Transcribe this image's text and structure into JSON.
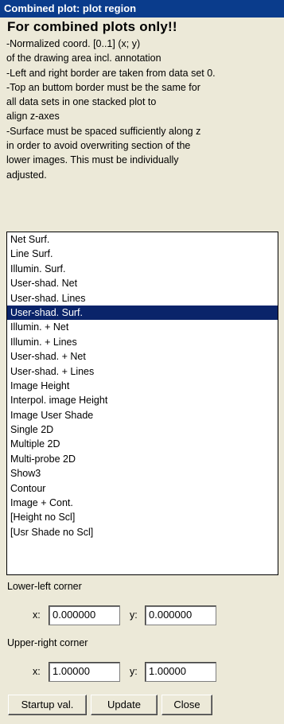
{
  "window": {
    "title": "Combined plot: plot region"
  },
  "heading": "For combined plots only!!",
  "info_lines": [
    "-Normalized coord. [0..1] (x; y)",
    "of the drawing area incl. annotation",
    "-Left and right border are taken from data set 0.",
    "-Top an buttom border must be the same for",
    "all data sets in one stacked plot to",
    "align z-axes",
    "-Surface must be spaced sufficiently along z",
    "in order to avoid overwriting section of the",
    "lower images. This must be individually",
    "adjusted."
  ],
  "plot_types": {
    "selected_index": 5,
    "items": [
      "Net Surf.",
      "Line Surf.",
      "Illumin. Surf.",
      "User-shad. Net",
      "User-shad. Lines",
      "User-shad. Surf.",
      "Illumin. + Net",
      "Illumin. + Lines",
      "User-shad. + Net",
      "User-shad. + Lines",
      "Image Height",
      "Interpol. image Height",
      "Image User Shade",
      "Single 2D",
      "Multiple 2D",
      "Multi-probe 2D",
      "Show3",
      "Contour",
      "Image + Cont.",
      "[Height no Scl]",
      "[Usr Shade no Scl]"
    ]
  },
  "lower_left": {
    "label": "Lower-left corner",
    "x_label": "x:",
    "y_label": "y:",
    "x_value": "0.000000",
    "y_value": "0.000000"
  },
  "upper_right": {
    "label": "Upper-right corner",
    "x_label": "x:",
    "y_label": "y:",
    "x_value": "1.00000",
    "y_value": "1.00000"
  },
  "buttons": {
    "startup": "Startup val.",
    "update": "Update",
    "close": "Close"
  },
  "colors": {
    "title_bar": "#0a3c8c",
    "selection": "#0a246a",
    "dialog_bg": "#ece9d8"
  }
}
